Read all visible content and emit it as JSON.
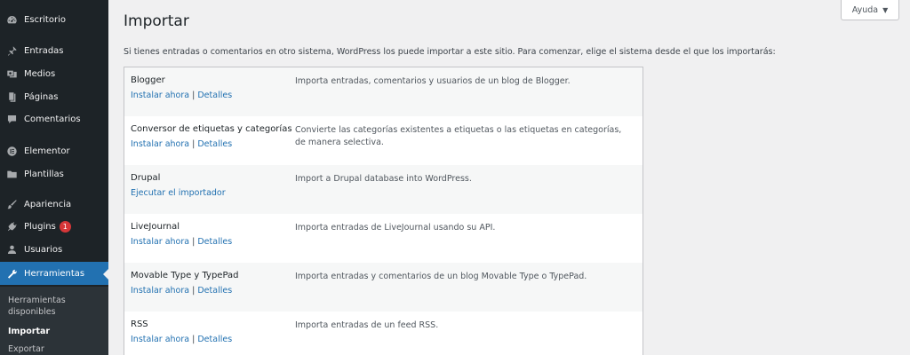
{
  "sidebar": {
    "items": [
      {
        "label": "Escritorio",
        "icon": "dashboard-icon"
      },
      {
        "label": "Entradas",
        "icon": "pin-icon"
      },
      {
        "label": "Medios",
        "icon": "media-icon"
      },
      {
        "label": "Páginas",
        "icon": "pages-icon"
      },
      {
        "label": "Comentarios",
        "icon": "comments-icon"
      },
      {
        "label": "Elementor",
        "icon": "elementor-icon"
      },
      {
        "label": "Plantillas",
        "icon": "folder-icon"
      },
      {
        "label": "Apariencia",
        "icon": "brush-icon"
      },
      {
        "label": "Plugins",
        "icon": "plugin-icon",
        "badge": "1"
      },
      {
        "label": "Usuarios",
        "icon": "users-icon"
      },
      {
        "label": "Herramientas",
        "icon": "wrench-icon",
        "active": true
      }
    ],
    "submenu": [
      {
        "label": "Herramientas disponibles"
      },
      {
        "label": "Importar",
        "current": true
      },
      {
        "label": "Exportar"
      }
    ]
  },
  "header": {
    "help_label": "Ayuda",
    "help_arrow": "▼",
    "title": "Importar",
    "intro": "Si tienes entradas o comentarios en otro sistema, WordPress los puede importar a este sitio. Para comenzar, elige el sistema desde el que los importarás:"
  },
  "importers": [
    {
      "name": "Blogger",
      "actions": [
        "Instalar ahora",
        "Detalles"
      ],
      "description": "Importa entradas, comentarios y usuarios de un blog de Blogger."
    },
    {
      "name": "Conversor de etiquetas y categorías",
      "actions": [
        "Instalar ahora",
        "Detalles"
      ],
      "description": "Convierte las categorías existentes a etiquetas o las etiquetas en categorías, de manera selectiva."
    },
    {
      "name": "Drupal",
      "actions": [
        "Ejecutar el importador"
      ],
      "description": "Import a Drupal database into WordPress."
    },
    {
      "name": "LiveJournal",
      "actions": [
        "Instalar ahora",
        "Detalles"
      ],
      "description": "Importa entradas de LiveJournal usando su API."
    },
    {
      "name": "Movable Type y TypePad",
      "actions": [
        "Instalar ahora",
        "Detalles"
      ],
      "description": "Importa entradas y comentarios de un blog Movable Type o TypePad."
    },
    {
      "name": "RSS",
      "actions": [
        "Instalar ahora",
        "Detalles"
      ],
      "description": "Importa entradas de un feed RSS."
    }
  ],
  "separator": "|",
  "colors": {
    "sidebar_bg": "#1d2327",
    "active": "#2271b1",
    "link": "#2271b1",
    "badge": "#d63638"
  }
}
